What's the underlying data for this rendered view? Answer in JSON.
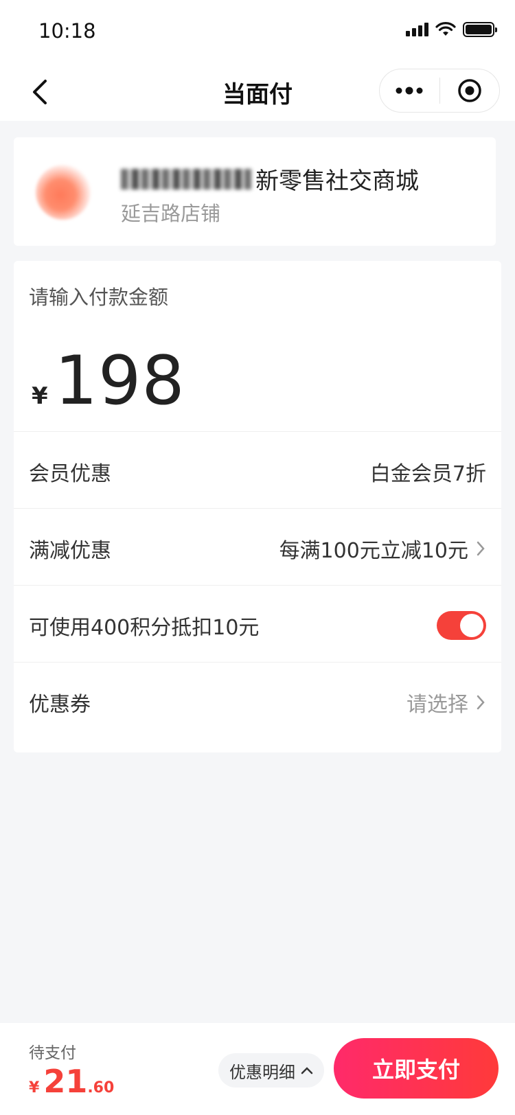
{
  "status_bar": {
    "time": "10:18"
  },
  "nav": {
    "title": "当面付"
  },
  "shop": {
    "name": "新零售社交商城",
    "branch": "延吉路店铺"
  },
  "payment": {
    "amount_label": "请输入付款金额",
    "currency": "¥",
    "amount": "198"
  },
  "discounts": {
    "member": {
      "label": "会员优惠",
      "value": "白金会员7折"
    },
    "full_reduction": {
      "label": "满减优惠",
      "value": "每满100元立减10元"
    },
    "points": {
      "label": "可使用400积分抵扣10元",
      "enabled": true
    },
    "coupon": {
      "label": "优惠券",
      "value": "请选择"
    }
  },
  "bottom": {
    "pending_label": "待支付",
    "currency": "¥",
    "amount_int": "21",
    "amount_dec": ".60",
    "detail_label": "优惠明细",
    "pay_label": "立即支付"
  },
  "colors": {
    "accent": "#f5413a",
    "pay_gradient_start": "#ff2a6a",
    "pay_gradient_end": "#ff3a3a"
  }
}
